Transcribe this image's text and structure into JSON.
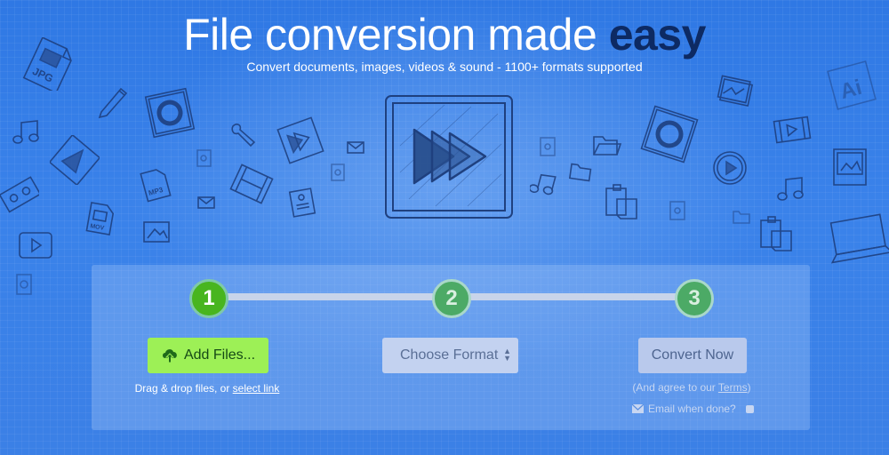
{
  "hero": {
    "title_main": "File conversion made ",
    "title_accent": "easy",
    "subtitle": "Convert documents, images, videos & sound - 1100+ formats supported"
  },
  "steps": [
    {
      "number": "1",
      "state": "active"
    },
    {
      "number": "2",
      "state": "pending"
    },
    {
      "number": "3",
      "state": "pending"
    }
  ],
  "step1": {
    "button_label": "Add Files...",
    "icon": "cloud-upload-icon",
    "drag_text": "Drag & drop files, or ",
    "select_link": "select link"
  },
  "step2": {
    "select_value": "Choose Format"
  },
  "step3": {
    "button_label": "Convert Now",
    "terms_prefix": "(And agree to our ",
    "terms_link": "Terms",
    "terms_suffix": ")",
    "email_label": "Email when done?",
    "email_icon": "envelope-icon",
    "email_checked": false
  },
  "doodles": {
    "jpg_label": "JPG",
    "mp3_label": "MP3",
    "mov_label": "MOV",
    "ai_label": "Ai"
  },
  "colors": {
    "background": "#3a82ea",
    "accent_text": "#0d2a63",
    "add_button": "#9df056",
    "step_active": "#48b51f",
    "step_pending": "#4caa66"
  }
}
